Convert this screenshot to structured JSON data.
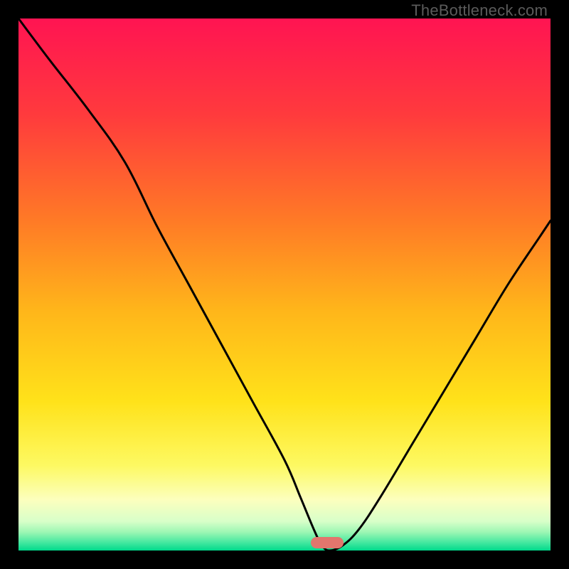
{
  "watermark": {
    "text": "TheBottleneck.com"
  },
  "colors": {
    "gradient_stops": [
      {
        "offset": 0.0,
        "color": "#ff1452"
      },
      {
        "offset": 0.18,
        "color": "#ff3a3d"
      },
      {
        "offset": 0.38,
        "color": "#ff7a26"
      },
      {
        "offset": 0.55,
        "color": "#ffb61a"
      },
      {
        "offset": 0.72,
        "color": "#ffe21a"
      },
      {
        "offset": 0.84,
        "color": "#fdf962"
      },
      {
        "offset": 0.905,
        "color": "#fcffbe"
      },
      {
        "offset": 0.945,
        "color": "#d8ffc9"
      },
      {
        "offset": 0.965,
        "color": "#9ef7b4"
      },
      {
        "offset": 0.985,
        "color": "#45e8a0"
      },
      {
        "offset": 1.0,
        "color": "#00d98b"
      }
    ],
    "curve": "#000000",
    "marker": "#e2766d",
    "background": "#000000"
  },
  "chart_data": {
    "type": "line",
    "title": "",
    "xlabel": "",
    "ylabel": "",
    "xlim": [
      0,
      100
    ],
    "ylim": [
      0,
      100
    ],
    "grid": false,
    "legend": false,
    "series": [
      {
        "name": "bottleneck-curve",
        "x": [
          0,
          6,
          13,
          20,
          26,
          32,
          38,
          44,
          50,
          53,
          55.5,
          57,
          58.5,
          61,
          64,
          68,
          74,
          80,
          86,
          92,
          98,
          100
        ],
        "y": [
          100,
          92,
          83,
          73,
          61,
          50,
          39,
          28,
          17,
          10,
          4,
          1,
          0,
          1,
          4,
          10,
          20,
          30,
          40,
          50,
          59,
          62
        ]
      }
    ],
    "annotations": [
      {
        "type": "marker",
        "shape": "pill",
        "x": 58,
        "y": 1.5,
        "width_pct": 6.2,
        "height_pct": 2.2
      }
    ]
  }
}
